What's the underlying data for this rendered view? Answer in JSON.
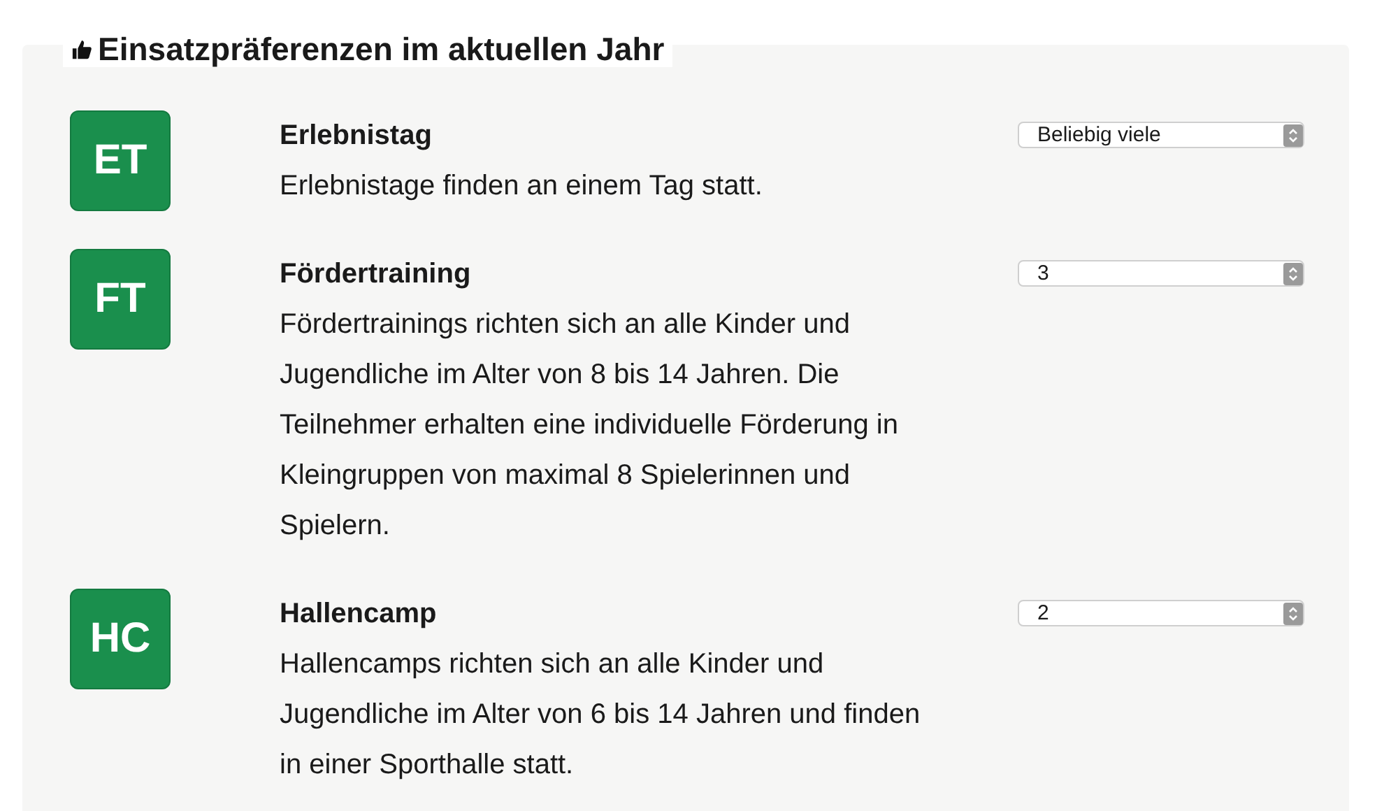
{
  "section": {
    "title": "Einsatzpräferenzen im aktuellen Jahr"
  },
  "items": [
    {
      "badge": "ET",
      "title": "Erlebnistag",
      "description": "Erlebnistage finden an einem Tag statt.",
      "select": {
        "value": "Beliebig viele"
      }
    },
    {
      "badge": "FT",
      "title": "Fördertraining",
      "description": "Fördertrainings richten sich an alle Kinder und Jugendliche im Alter von 8 bis 14 Jahren. Die Teilnehmer erhalten eine individuelle Förderung in Kleingruppen von maximal 8 Spielerinnen und Spielern.",
      "select": {
        "value": "3"
      }
    },
    {
      "badge": "HC",
      "title": "Hallencamp",
      "description": "Hallencamps richten sich an alle Kinder und Jugendliche im Alter von 6 bis 14 Jahren und finden in einer Sporthalle statt.",
      "select": {
        "value": "2"
      }
    }
  ]
}
